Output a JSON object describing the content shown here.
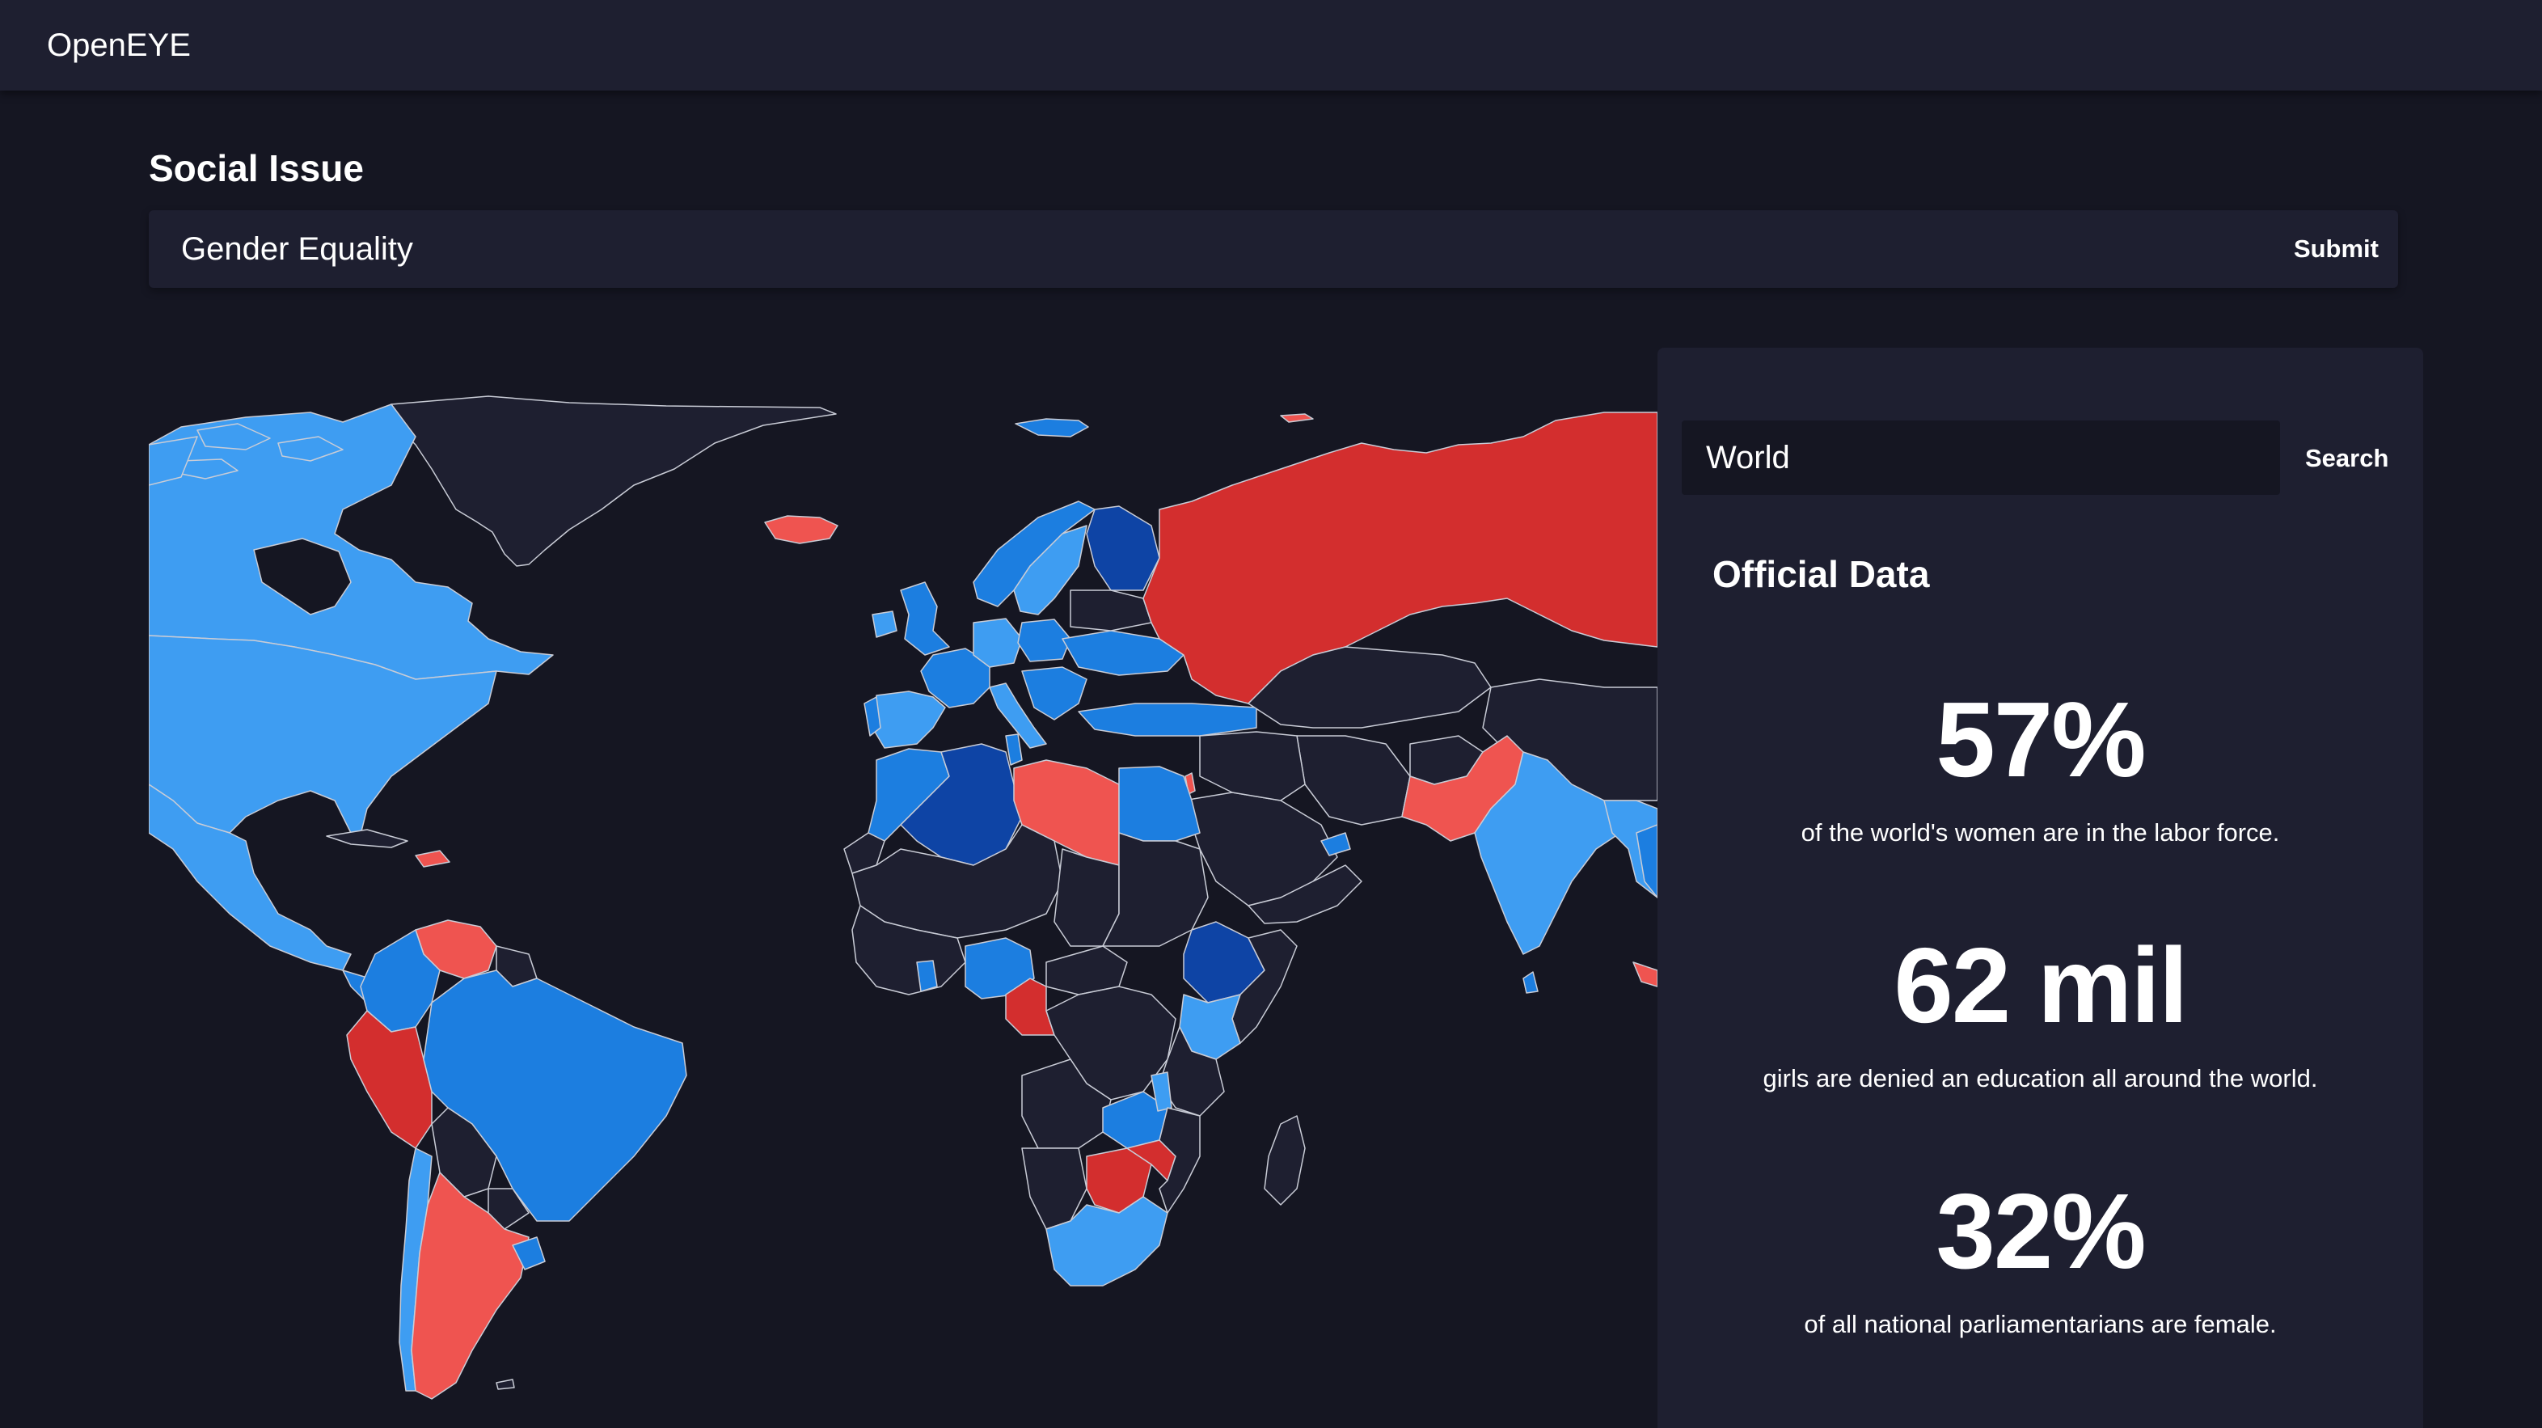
{
  "app": {
    "title": "OpenEYE"
  },
  "issue": {
    "heading": "Social Issue",
    "value": "Gender Equality",
    "submit_label": "Submit"
  },
  "panel": {
    "region_value": "World",
    "search_label": "Search",
    "title": "Official Data",
    "stats": [
      {
        "value": "57%",
        "caption": "of the world's women are in the labor force."
      },
      {
        "value": "62 mil",
        "caption": "girls are denied an education all around the world."
      },
      {
        "value": "32%",
        "caption": "of all national parliamentarians are female."
      }
    ]
  },
  "map": {
    "colors": {
      "background": "#151622",
      "no_data": "#1e1f30",
      "border": "#c9ccd6",
      "light_blue": "#3e9df2",
      "mid_blue": "#1c7ee0",
      "dark_blue": "#0e44a5",
      "light_red": "#ef5450",
      "dark_red": "#d32e2e"
    }
  }
}
